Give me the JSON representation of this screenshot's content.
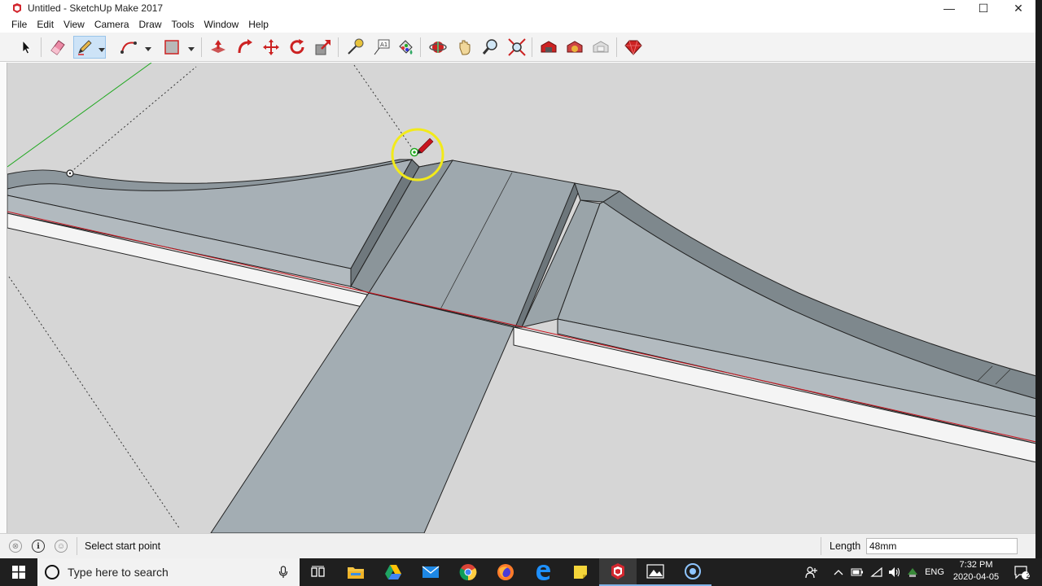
{
  "window": {
    "title": "Untitled - SketchUp Make 2017"
  },
  "window_controls": {
    "minimize": "—",
    "maximize": "☐",
    "close": "✕"
  },
  "menu": [
    "File",
    "Edit",
    "View",
    "Camera",
    "Draw",
    "Tools",
    "Window",
    "Help"
  ],
  "toolbar": {
    "tools": [
      "select",
      "eraser",
      "line",
      "arc",
      "rectangle",
      "push-pull",
      "follow-me",
      "move",
      "rotate",
      "scale",
      "tape-measure",
      "text",
      "paint-bucket",
      "orbit",
      "pan",
      "zoom",
      "zoom-extents",
      "3d-warehouse",
      "extension-warehouse",
      "layout",
      "extension-manager"
    ],
    "active_tool": "line"
  },
  "statusbar": {
    "hint": "Select start point",
    "measurement_label": "Length",
    "measurement_value": "48mm"
  },
  "taskbar": {
    "search_placeholder": "Type here to search",
    "apps": [
      "task-view",
      "file-explorer",
      "google-drive",
      "mail",
      "chrome",
      "firefox",
      "edge",
      "sticky-notes",
      "sketchup",
      "photos",
      "cortana-media"
    ],
    "tray_language": "ENG",
    "time": "7:32 PM",
    "date": "2020-04-05",
    "notification_count": "2"
  },
  "colors": {
    "viewport_bg": "#d6d6d6",
    "model_face": "#a3adb3",
    "model_face_dark": "#7e888d",
    "red_axis": "#c8141e",
    "green_axis": "#1fa81f",
    "cursor_ring": "#f2ea1a",
    "taskbar": "#1f1f1f"
  }
}
